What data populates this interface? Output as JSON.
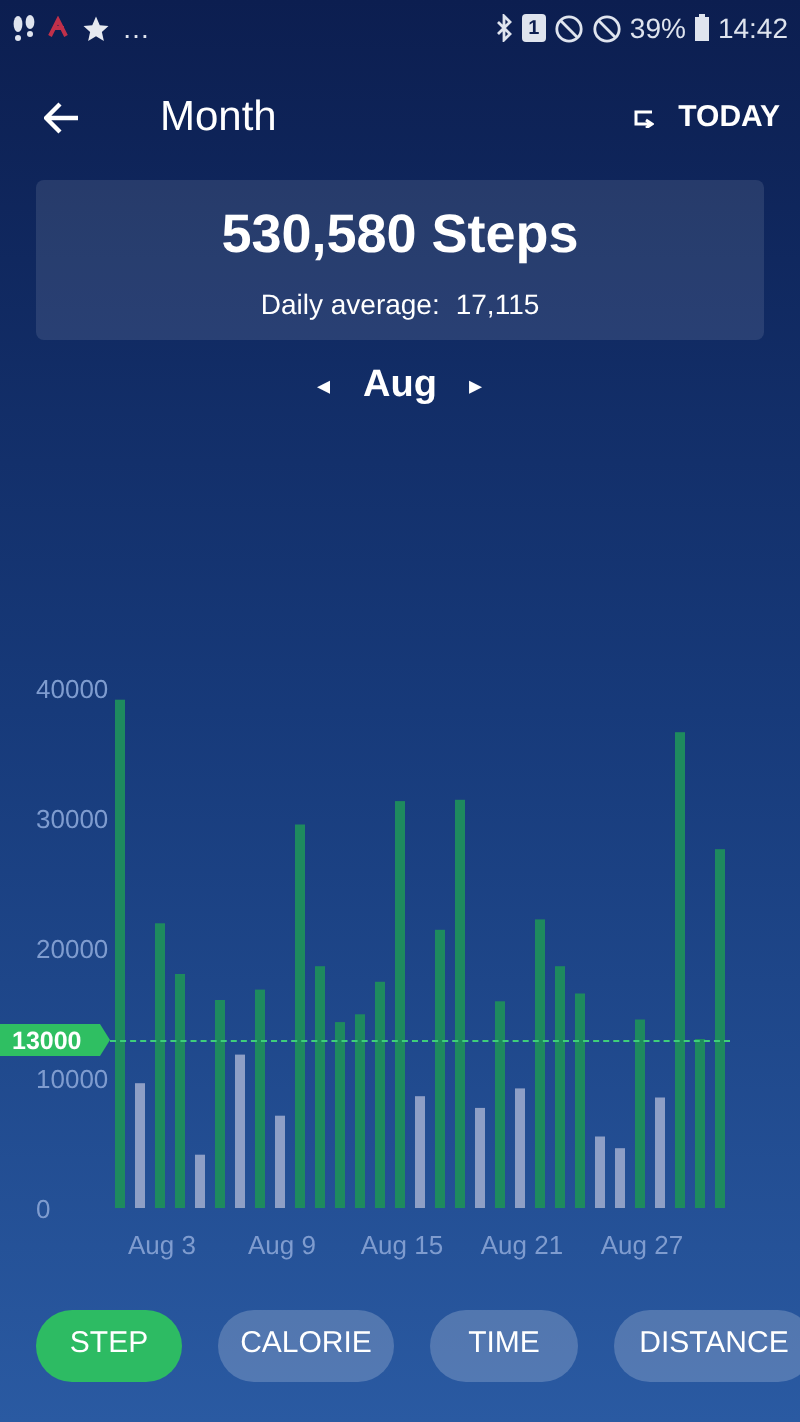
{
  "status_bar": {
    "overflow": "…",
    "sim": "1",
    "battery": "39%",
    "time": "14:42"
  },
  "header": {
    "title": "Month",
    "today": "TODAY"
  },
  "summary": {
    "total": "530,580 Steps",
    "average_label": "Daily average:",
    "average": "17,115"
  },
  "month": {
    "prev": "◂",
    "label": "Aug",
    "next": "▸"
  },
  "chart_data": {
    "type": "bar",
    "categories": [
      null,
      null,
      "Aug 3",
      null,
      null,
      null,
      null,
      null,
      "Aug 9",
      null,
      null,
      null,
      null,
      null,
      "Aug 15",
      null,
      null,
      null,
      null,
      null,
      "Aug 21",
      null,
      null,
      null,
      null,
      null,
      "Aug 27",
      null,
      null,
      null,
      null
    ],
    "series": [
      {
        "color": "#1e8a5e",
        "values": [
          39100,
          null,
          21900,
          18000,
          null,
          16000,
          null,
          16800,
          null,
          29500,
          18600,
          14300,
          14900,
          17400,
          31300,
          null,
          21400,
          31400,
          null,
          15900,
          null,
          22200,
          18600,
          16500,
          null,
          null,
          14500,
          null,
          36600,
          13000,
          27600
        ]
      },
      {
        "color": "#8e9fc6",
        "values": [
          null,
          9600,
          null,
          null,
          4100,
          null,
          11800,
          null,
          7100,
          null,
          null,
          null,
          null,
          null,
          null,
          8600,
          null,
          null,
          7700,
          null,
          9200,
          null,
          null,
          null,
          5500,
          4600,
          null,
          8500,
          null,
          null,
          null
        ]
      }
    ],
    "ylim": [
      0,
      40000
    ],
    "yticks": [
      0,
      10000,
      20000,
      30000,
      40000
    ]
  },
  "goal": {
    "label": "13000"
  },
  "tabs": [
    {
      "label": "STEP",
      "selected": true
    },
    {
      "label": "CALORIE",
      "selected": false
    },
    {
      "label": "TIME",
      "selected": false
    },
    {
      "label": "DISTANCE",
      "selected": false
    }
  ]
}
